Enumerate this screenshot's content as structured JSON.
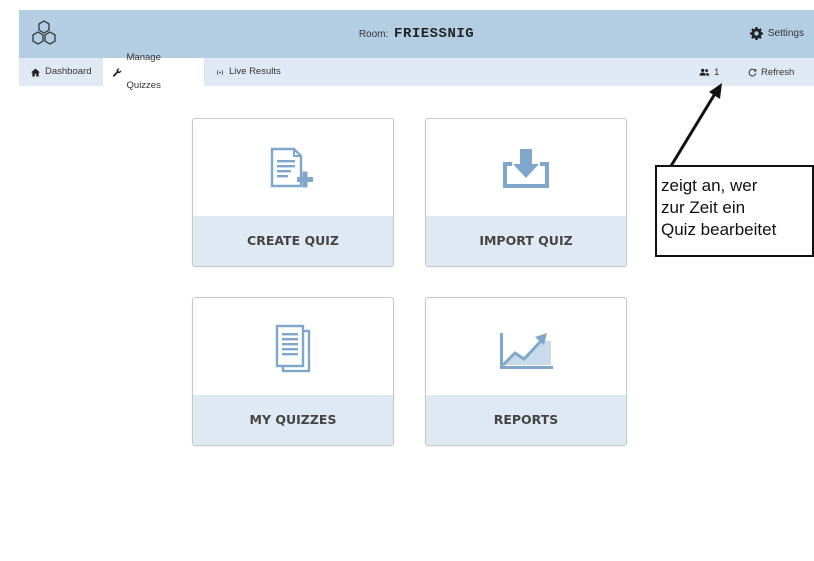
{
  "header": {
    "room_label": "Room:",
    "room_name": "FRIESSNIG",
    "settings_label": "Settings"
  },
  "nav": {
    "tabs": [
      {
        "label": "Dashboard",
        "icon": "home-icon",
        "active": false
      },
      {
        "label": "Manage Quizzes",
        "icon": "wrench-icon",
        "active": true
      },
      {
        "label": "Live Results",
        "icon": "broadcast-icon",
        "active": false
      }
    ],
    "user_count": "1",
    "refresh_label": "Refresh"
  },
  "cards": [
    {
      "label": "CREATE QUIZ",
      "icon": "create-quiz-icon"
    },
    {
      "label": "IMPORT QUIZ",
      "icon": "import-icon"
    },
    {
      "label": "MY QUIZZES",
      "icon": "documents-icon"
    },
    {
      "label": "REPORTS",
      "icon": "chart-icon"
    }
  ],
  "annotation": {
    "lines": [
      "zeigt an, wer",
      "zur Zeit ein",
      "Quiz bearbeitet"
    ]
  },
  "colors": {
    "header_bg": "#b3cde3",
    "nav_bg": "#dfe9f3",
    "icon_blue": "#7fa7cb",
    "card_label_bg": "#dfe9f3"
  }
}
